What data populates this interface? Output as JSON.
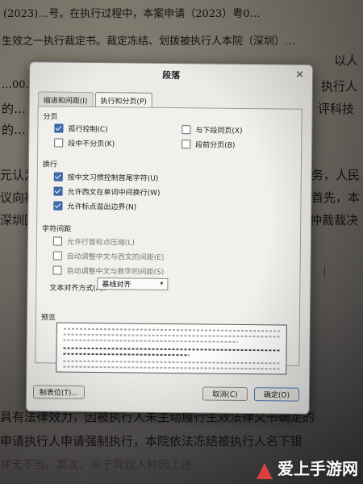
{
  "background_text": {
    "lines": [
      "(2023)…号。在执行过程中，本案申请（2023）粤0…",
      "生效之一执行裁定书。裁定冻结、划拨被执行人本院（深圳）…",
      "…00…",
      "的…",
      "的…",
      "元认为…",
      "议向被…",
      "深圳国…",
      "具有法律效力，因被执行人未主动履行生效法律文书确定的",
      "申请执行人申请强制执行，本院依法冻结被执行人名下银",
      "并无不当。其次，关于异议人称因上述…"
    ],
    "right_fragments": [
      "以人",
      "执行人",
      "评科技",
      "务，人民",
      "首先，本",
      "仲裁裁决"
    ]
  },
  "dialog": {
    "title": "段落",
    "close_glyph": "✕",
    "tabs": [
      {
        "label": "缩进和间距(I)",
        "active": false
      },
      {
        "label": "执行和分页(P)",
        "active": true
      }
    ],
    "sections": {
      "pagination": {
        "heading": "分页",
        "options": [
          {
            "label": "孤行控制(C)",
            "checked": true
          },
          {
            "label": "与下段同页(X)",
            "checked": false
          },
          {
            "label": "段中不分页(K)",
            "checked": false
          },
          {
            "label": "段前分页(B)",
            "checked": false
          }
        ]
      },
      "line_break": {
        "heading": "换行",
        "options": [
          {
            "label": "按中文习惯控制首尾字符(U)",
            "checked": true
          },
          {
            "label": "允许西文在单词中间换行(W)",
            "checked": true
          },
          {
            "label": "允许标点溢出边界(N)",
            "checked": true
          }
        ]
      },
      "char_spacing": {
        "heading": "字符间距",
        "options": [
          {
            "label": "允许行首标点压缩(L)",
            "checked": false
          },
          {
            "label": "自动调整中文与西文的间距(E)",
            "checked": false
          },
          {
            "label": "自动调整中文与数字的间距(S)",
            "checked": false
          }
        ]
      }
    },
    "text_alignment": {
      "label": "文本对齐方式(A):",
      "value": "基线对齐"
    },
    "preview_label": "预览",
    "buttons": {
      "tabs": "制表位(T)...",
      "cancel": "取消(C)",
      "ok": "确定(O)"
    }
  },
  "watermark": {
    "text": "爱上手游网",
    "accent": "#d94040"
  }
}
